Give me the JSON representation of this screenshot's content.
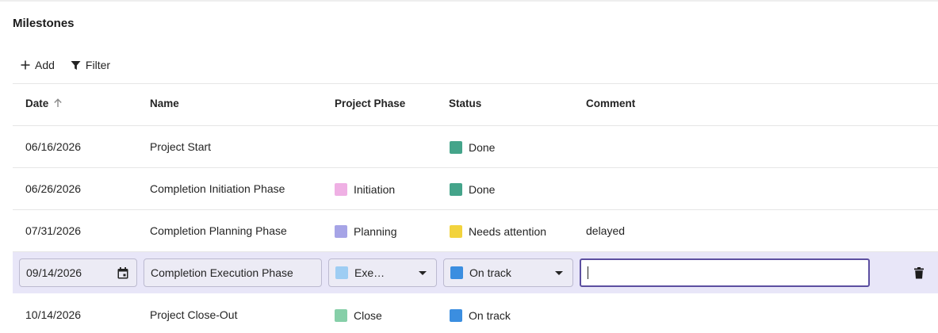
{
  "panel": {
    "title": "Milestones"
  },
  "toolbar": {
    "add_label": "Add",
    "filter_label": "Filter"
  },
  "columns": {
    "date": "Date",
    "name": "Name",
    "phase": "Project Phase",
    "status": "Status",
    "comment": "Comment"
  },
  "colors": {
    "done": "#44a48a",
    "on_track": "#3b8ee0",
    "needs_attention": "#f2d33d",
    "initiation": "#efb0e4",
    "planning": "#a6a4e6",
    "execution": "#9ecdf3",
    "close": "#86cfa8",
    "edit_row_bg": "#e8e6f8",
    "focus_border": "#5c4fa0"
  },
  "rows": [
    {
      "date": "06/16/2026",
      "name": "Project Start",
      "phase": "",
      "status": "Done",
      "comment": ""
    },
    {
      "date": "06/26/2026",
      "name": "Completion Initiation Phase",
      "phase": "Initiation",
      "status": "Done",
      "comment": ""
    },
    {
      "date": "07/31/2026",
      "name": "Completion Planning Phase",
      "phase": "Planning",
      "status": "Needs attention",
      "comment": "delayed"
    },
    {
      "date": "09/14/2026",
      "name": "Completion Execution Phase",
      "phase": "Exe…",
      "status": "On track",
      "comment": ""
    },
    {
      "date": "10/14/2026",
      "name": "Project Close-Out",
      "phase": "Close",
      "status": "On track",
      "comment": ""
    }
  ],
  "icons": {
    "add": "plus-icon",
    "filter": "funnel-icon",
    "sort": "arrow-up-icon",
    "calendar": "calendar-icon",
    "delete": "trash-icon"
  }
}
